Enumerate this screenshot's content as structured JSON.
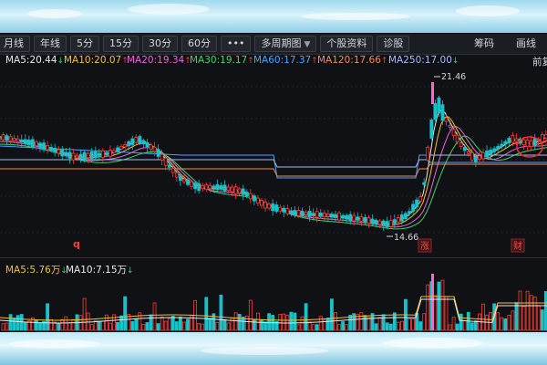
{
  "toolbar": {
    "items": [
      {
        "label": "月线",
        "name": "tab-monthly"
      },
      {
        "label": "年线",
        "name": "tab-yearly"
      },
      {
        "label": "5分",
        "name": "tab-5min"
      },
      {
        "label": "15分",
        "name": "tab-15min"
      },
      {
        "label": "30分",
        "name": "tab-30min"
      },
      {
        "label": "60分",
        "name": "tab-60min"
      },
      {
        "label": "•••",
        "name": "more-periods-button"
      }
    ],
    "multi_period": "多周期图",
    "stock_info": "个股资料",
    "diagnose": "诊股",
    "right": {
      "chips": "筹码",
      "draw": "画线"
    }
  },
  "ma_legend": [
    {
      "label": "MA5:20.44",
      "dir": "down",
      "color": "#e8e8e8"
    },
    {
      "label": "MA10:20.07",
      "dir": "up",
      "color": "#f2c12e"
    },
    {
      "label": "MA20:19.34",
      "dir": "up",
      "color": "#e866d8"
    },
    {
      "label": "MA30:19.17",
      "dir": "up",
      "color": "#3dd66b"
    },
    {
      "label": "MA60:17.37",
      "dir": "up",
      "color": "#4aa3ff"
    },
    {
      "label": "MA120:17.66",
      "dir": "up",
      "color": "#f08a5d"
    },
    {
      "label": "MA250:17.00",
      "dir": "down",
      "color": "#a8b8ff"
    }
  ],
  "ma_legend_tail": "前复",
  "vol_legend": [
    {
      "label": "MA5:5.76万",
      "dir": "down",
      "color": "#f2c12e"
    },
    {
      "label": "MA10:7.15万",
      "dir": "down",
      "color": "#e8e8e8"
    }
  ],
  "price_chart": {
    "high_label": "21.46",
    "low_label": "14.66",
    "markers": [
      {
        "text": "q",
        "kind": "plain"
      },
      {
        "text": "涨",
        "kind": "boxed"
      },
      {
        "text": "财",
        "kind": "boxed"
      }
    ]
  },
  "colors": {
    "up": "#ff3b3b",
    "down": "#19c1c8",
    "bg": "#0f1114"
  }
}
